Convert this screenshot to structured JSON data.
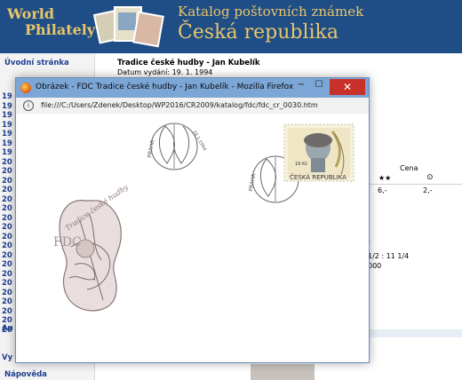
{
  "header": {
    "logo_line1": "World",
    "logo_line2": "Philately",
    "catalog_line1": "Katalog poštovních známek",
    "catalog_line2": "Česká republika"
  },
  "sidebar": {
    "home_link": "Úvodní stránka",
    "years": [
      "19",
      "19",
      "19",
      "19",
      "19",
      "19",
      "19",
      "20",
      "20",
      "20",
      "20",
      "20",
      "20",
      "20",
      "20",
      "20",
      "20",
      "20",
      "20",
      "20",
      "20",
      "20",
      "20",
      "20",
      "20",
      "20"
    ],
    "link_au": "Au",
    "link_vy": "Vy",
    "help_link": "Nápověda"
  },
  "detail": {
    "title": "Tradice české hudby - Jan Kubelík",
    "date_label": "Datum vydání: 19. 1. 1994",
    "price_header": "Cena",
    "col_mint": "★★",
    "col_used": "⊙",
    "price_mint": "6,-",
    "price_used": "2,-",
    "perforation_text": "1/2 : 11 1/4",
    "misc_text": "000",
    "dash": "-"
  },
  "popup": {
    "title": "Obrázek - FDC Tradice české hudby - Jan Kubelík - Mozilla Firefox",
    "url": "file:///C:/Users/Zdenek/Desktop/WP2016/CR2009/katalog/fdc/fdc_cr_0030.htm",
    "min_glyph": "−",
    "max_glyph": "☐",
    "close_glyph": "✕",
    "info_glyph": "i"
  },
  "fdc": {
    "cachet_text": "Tradice české hudby",
    "fdc_label": "FDC",
    "cancel_city": "PRAHA",
    "cancel_date": "19.1.1994",
    "stamp_country": "ČESKÁ REPUBLIKA",
    "stamp_value": "19 Kč"
  }
}
